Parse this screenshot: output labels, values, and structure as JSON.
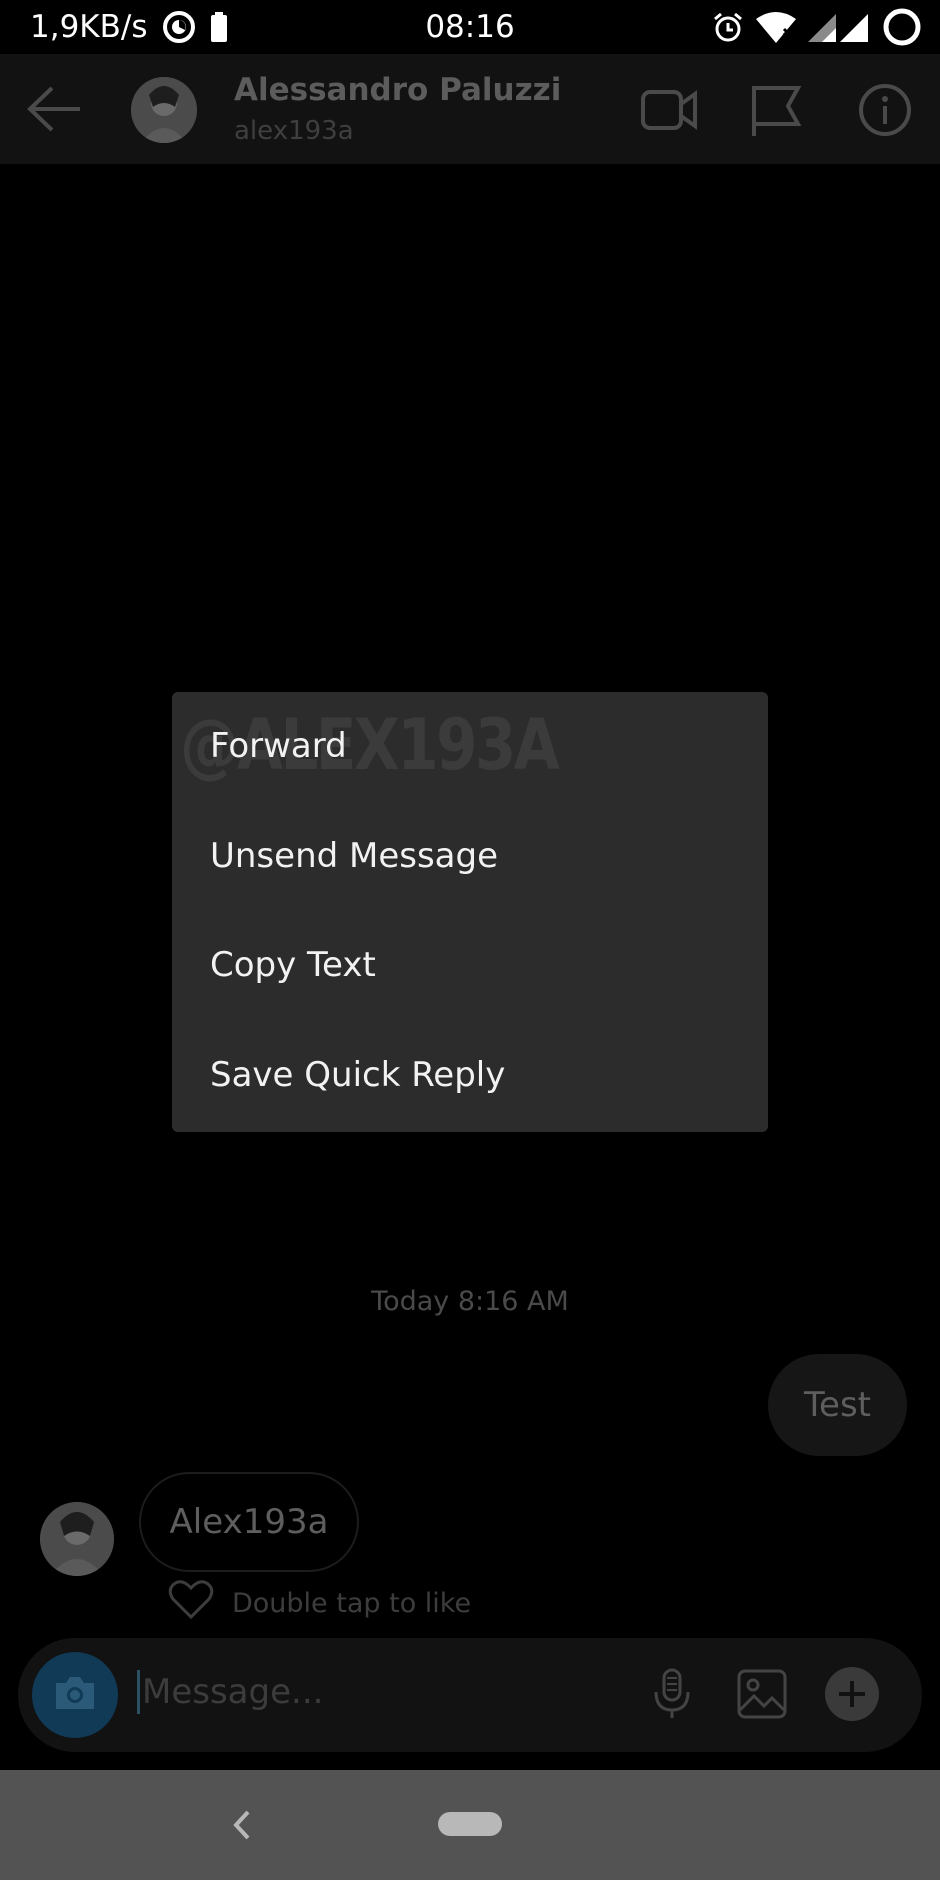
{
  "status_bar": {
    "net_speed": "1,9KB/s",
    "time": "08:16"
  },
  "header": {
    "name": "Alessandro Paluzzi",
    "username": "alex193a"
  },
  "chat": {
    "timestamp": "Today 8:16 AM",
    "outgoing_message": "Test",
    "incoming_message": "Alex193a",
    "like_hint": "Double tap to like"
  },
  "composer": {
    "placeholder": "Message..."
  },
  "context_menu": {
    "watermark": "@ALEX193A",
    "items": [
      "Forward",
      "Unsend Message",
      "Copy Text",
      "Save Quick Reply"
    ]
  },
  "colors": {
    "camera_button": "#113a57",
    "menu_background": "#2c2c2c",
    "nav_bar": "#535353"
  },
  "icons": [
    "sync-icon",
    "battery-icon",
    "alarm-icon",
    "wifi-icon",
    "signal-icon",
    "circle-icon",
    "back-arrow-icon",
    "video-call-icon",
    "flag-icon",
    "info-icon",
    "heart-icon",
    "camera-icon",
    "mic-icon",
    "gallery-icon",
    "plus-icon",
    "nav-back-icon"
  ]
}
